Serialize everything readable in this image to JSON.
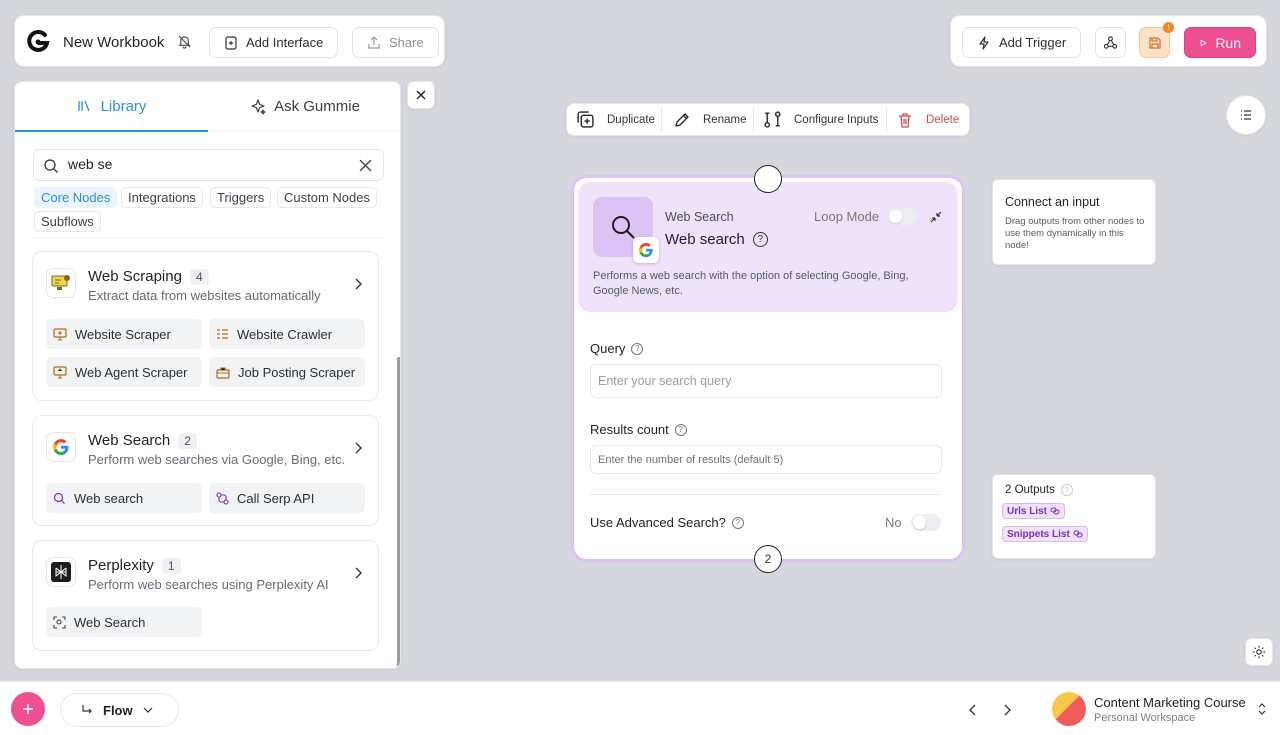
{
  "header": {
    "title": "New Workbook",
    "add_interface": "Add Interface",
    "share": "Share",
    "add_trigger": "Add Trigger",
    "run": "Run",
    "save_badge": "!"
  },
  "library": {
    "tab_library": "Library",
    "tab_ask": "Ask Gummie",
    "search_value": "web se",
    "search_placeholder": "Search",
    "filters": [
      "Core Nodes",
      "Integrations",
      "Triggers",
      "Custom Nodes",
      "Subflows"
    ],
    "groups": [
      {
        "title": "Web Scraping",
        "count": "4",
        "desc": "Extract data from websites automatically",
        "items": [
          "Website Scraper",
          "Website Crawler",
          "Web Agent Scraper",
          "Job Posting Scraper"
        ]
      },
      {
        "title": "Web Search",
        "count": "2",
        "desc": "Perform web searches via Google, Bing, etc.",
        "items": [
          "Web search",
          "Call Serp API"
        ]
      },
      {
        "title": "Perplexity",
        "count": "1",
        "desc": "Perform web searches using Perplexity AI",
        "items": [
          "Web Search"
        ]
      }
    ]
  },
  "toolbar": {
    "duplicate": "Duplicate",
    "rename": "Rename",
    "configure": "Configure Inputs",
    "delete": "Delete"
  },
  "node": {
    "kind": "Web Search",
    "title": "Web search",
    "loop_mode": "Loop Mode",
    "desc": "Performs a web search with the option of selecting Google, Bing, Google News, etc.",
    "query_label": "Query",
    "query_placeholder": "Enter your search query",
    "results_label": "Results count",
    "results_placeholder": "Enter the number of results (default 5)",
    "advanced_label": "Use Advanced Search?",
    "advanced_value": "No",
    "bottom_port": "2"
  },
  "connect": {
    "title": "Connect an input",
    "desc": "Drag outputs from other nodes to use them dynamically in this node!"
  },
  "outputs": {
    "title": "2 Outputs",
    "items": [
      "Urls List",
      "Snippets List"
    ]
  },
  "footer": {
    "flow": "Flow",
    "workspace_name": "Content Marketing Course",
    "workspace_sub": "Personal Workspace"
  },
  "colors": {
    "accent": "#e8478a",
    "node_border": "#dcc3f5",
    "node_header": "#efe3fb",
    "link": "#2b8fd6"
  }
}
